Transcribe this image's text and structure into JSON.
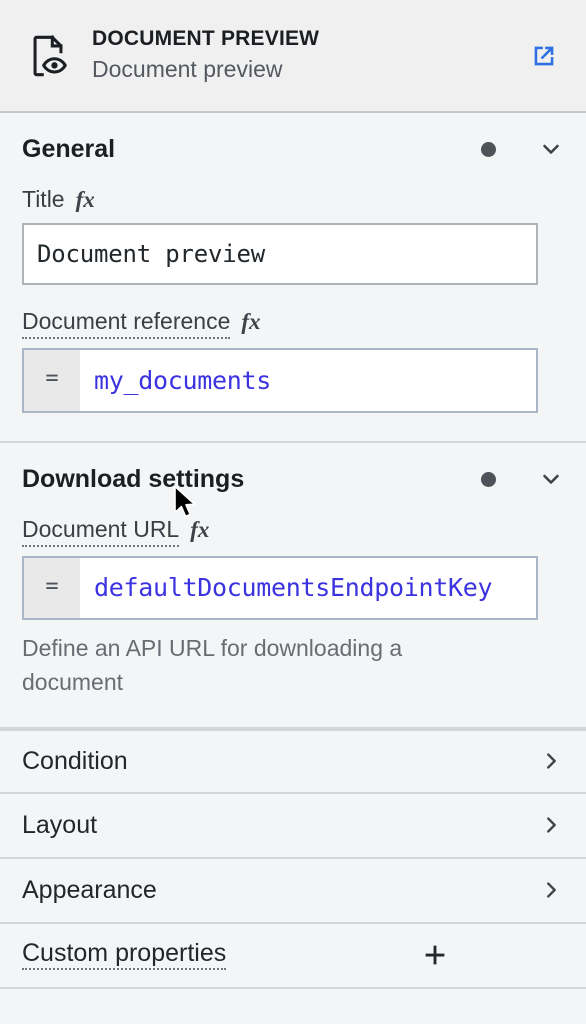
{
  "header": {
    "icon": "document-preview-icon",
    "kicker": "DOCUMENT PREVIEW",
    "title": "Document preview",
    "action_icon": "external-link-icon",
    "accent_color": "#2f6fe4"
  },
  "sections": [
    {
      "id": "general",
      "title": "General",
      "status_dot_color": "#4d5358",
      "expanded": true,
      "fields": [
        {
          "id": "title",
          "label": "Title",
          "fx_label": "fx",
          "dotted_label": false,
          "type": "text",
          "value": "Document preview",
          "placeholder": "Title"
        },
        {
          "id": "document-reference",
          "label": "Document reference",
          "fx_label": "fx",
          "dotted_label": true,
          "type": "expression",
          "prefix": "=",
          "value": "my_documents",
          "placeholder": "Document reference",
          "value_color": "#3b32e0"
        }
      ]
    },
    {
      "id": "download-settings",
      "title": "Download settings",
      "status_dot_color": "#4d5358",
      "expanded": true,
      "fields": [
        {
          "id": "document-url",
          "label": "Document URL",
          "fx_label": "fx",
          "dotted_label": true,
          "type": "expression",
          "prefix": "=",
          "value": "defaultDocumentsEndpointKey",
          "placeholder": "Document URL",
          "value_color": "#3b32e0",
          "helper": "Define an API URL for downloading a document"
        }
      ]
    }
  ],
  "collapsed_rows": [
    {
      "id": "condition",
      "label": "Condition",
      "chevron": "chevron-right-icon"
    },
    {
      "id": "layout",
      "label": "Layout",
      "chevron": "chevron-right-icon"
    },
    {
      "id": "appearance",
      "label": "Appearance",
      "chevron": "chevron-right-icon"
    }
  ],
  "custom_properties": {
    "label": "Custom properties",
    "add_icon": "plus-icon"
  }
}
